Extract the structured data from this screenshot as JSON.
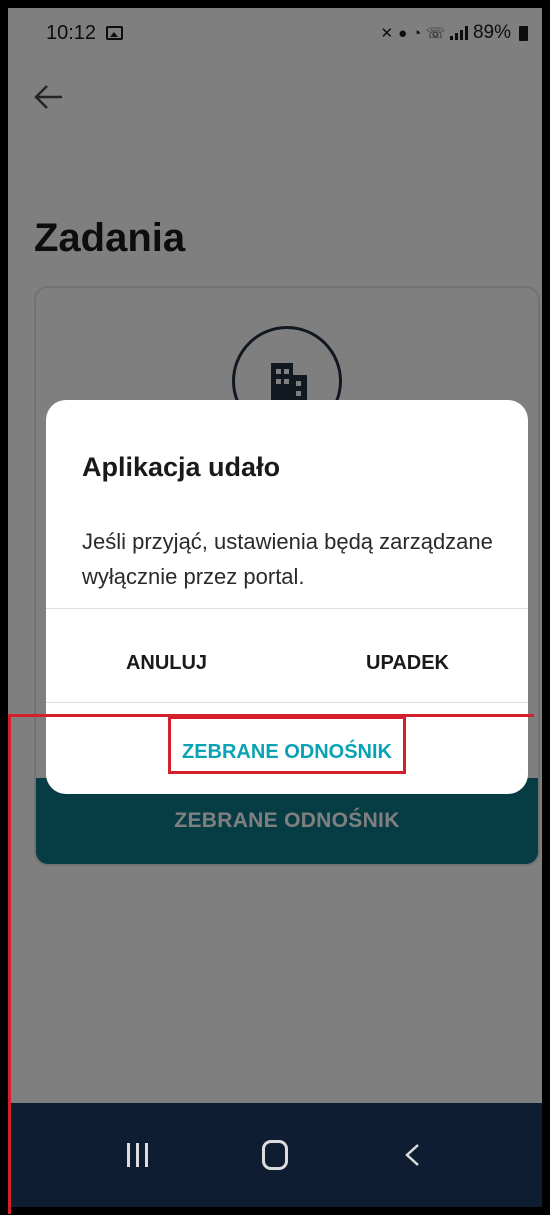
{
  "status_bar": {
    "time": "10:12",
    "battery": "89%",
    "icons": [
      "gallery-icon",
      "mute-icon",
      "location-icon",
      "wifi-icon",
      "wifi-calling-icon",
      "signal-icon",
      "battery-icon"
    ]
  },
  "header": {
    "back_icon": "arrow-left-icon",
    "title": "Zadania"
  },
  "card": {
    "icon": "building-icon",
    "collect_button_label": "ZEBRANE ODNOŚNIK"
  },
  "dialog": {
    "title": "Aplikacja udało",
    "message": "Jeśli przyjąć, ustawienia będą zarządzane wyłącznie przez portal.",
    "cancel_label": "ANULUJ",
    "fail_label": "UPADEK",
    "collect_label": "ZEBRANE ODNOŚNIK"
  },
  "nav_bar": {
    "icons": [
      "recent-apps-icon",
      "home-icon",
      "back-icon"
    ]
  },
  "colors": {
    "accent": "#0aa3b4",
    "card_button": "#0c7a8a",
    "nav_bar": "#0f1d33",
    "annotation": "#d4202a"
  }
}
